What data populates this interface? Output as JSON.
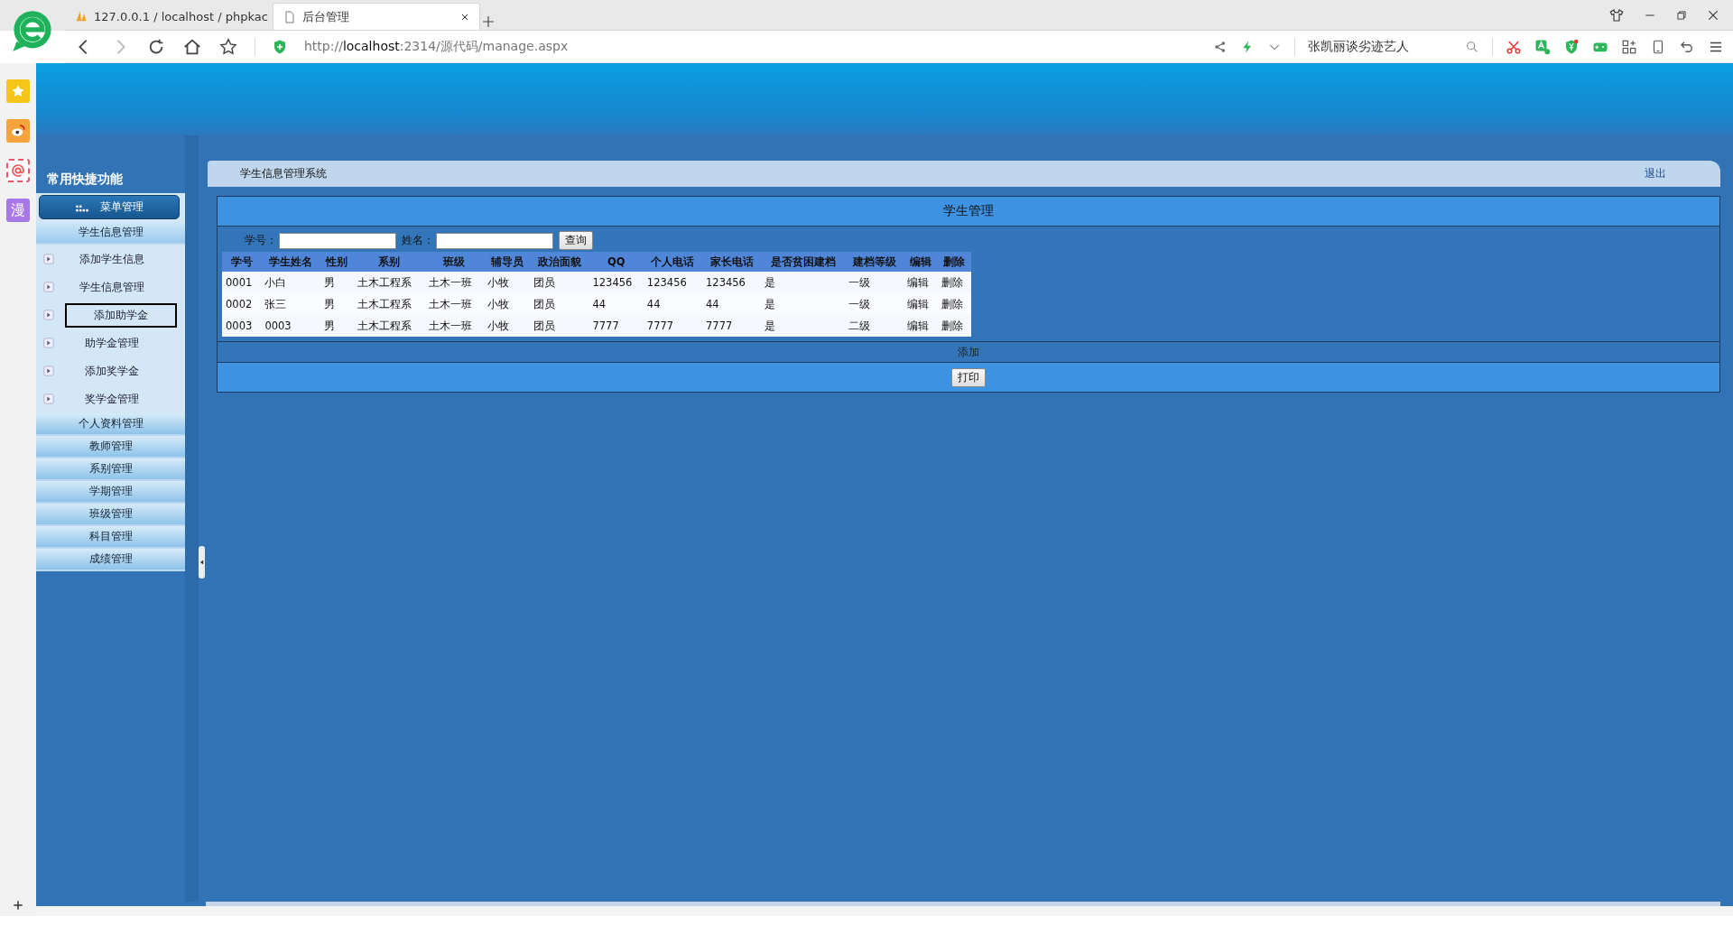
{
  "browser": {
    "tabs": [
      {
        "title": "127.0.0.1 / localhost / phpkac",
        "kind": "pma",
        "selected": false
      },
      {
        "title": "后台管理",
        "kind": "page",
        "selected": true
      }
    ],
    "url": {
      "scheme": "http://",
      "host": "localhost",
      "path": ":2314/源代码/manage.aspx"
    },
    "search_text": "张凯丽谈劣迹艺人"
  },
  "side_apps": [
    {
      "kind": "star"
    },
    {
      "kind": "weibo"
    },
    {
      "kind": "mail"
    },
    {
      "kind": "text",
      "label": "漫"
    }
  ],
  "quick_title": "常用快捷功能",
  "menu": {
    "title": "菜单管理",
    "groups": [
      {
        "label": "学生信息管理",
        "expanded": true,
        "items": [
          {
            "label": "添加学生信息",
            "selected": false
          },
          {
            "label": "学生信息管理",
            "selected": false
          },
          {
            "label": "添加助学金",
            "selected": true
          },
          {
            "label": "助学金管理",
            "selected": false
          },
          {
            "label": "添加奖学金",
            "selected": false
          },
          {
            "label": "奖学金管理",
            "selected": false
          }
        ]
      },
      {
        "label": "个人资料管理",
        "expanded": false
      },
      {
        "label": "教师管理",
        "expanded": false
      },
      {
        "label": "系别管理",
        "expanded": false
      },
      {
        "label": "学期管理",
        "expanded": false
      },
      {
        "label": "班级管理",
        "expanded": false
      },
      {
        "label": "科目管理",
        "expanded": false
      },
      {
        "label": "成绩管理",
        "expanded": false
      }
    ]
  },
  "header": {
    "system_name": "学生信息管理系统",
    "logout": "退出"
  },
  "panel": {
    "title": "学生管理",
    "search_fields": [
      {
        "label": "学号："
      },
      {
        "label": "姓名："
      }
    ],
    "search_button": "查询",
    "table": {
      "columns": [
        "学号",
        "学生姓名",
        "性别",
        "系别",
        "班级",
        "辅导员",
        "政治面貌",
        "QQ",
        "个人电话",
        "家长电话",
        "是否贫困建档",
        "建档等级",
        "编辑",
        "删除"
      ],
      "rows": [
        [
          "0001",
          "小白",
          "男",
          "土木工程系",
          "土木一班",
          "小牧",
          "团员",
          "123456",
          "123456",
          "123456",
          "是",
          "一级",
          "编辑",
          "删除"
        ],
        [
          "0002",
          "张三",
          "男",
          "土木工程系",
          "土木一班",
          "小牧",
          "团员",
          "44",
          "44",
          "44",
          "是",
          "一级",
          "编辑",
          "删除"
        ],
        [
          "0003",
          "0003",
          "男",
          "土木工程系",
          "土木一班",
          "小牧",
          "团员",
          "7777",
          "7777",
          "7777",
          "是",
          "二级",
          "编辑",
          "删除"
        ]
      ]
    },
    "add_link": "添加",
    "print_button": "打印"
  }
}
